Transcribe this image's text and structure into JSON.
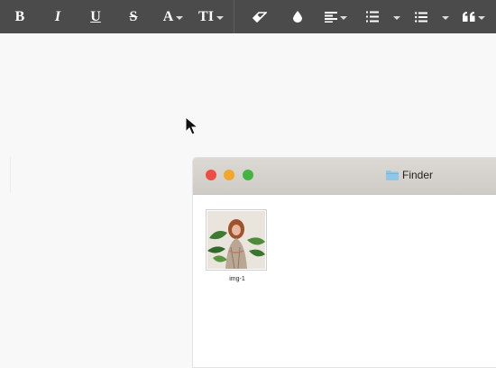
{
  "toolbar": {
    "items": [
      {
        "name": "bold-button",
        "label": "B",
        "style": "bold"
      },
      {
        "name": "italic-button",
        "label": "I",
        "style": "italic"
      },
      {
        "name": "underline-button",
        "label": "U",
        "style": "underline"
      },
      {
        "name": "strikethrough-button",
        "label": "S",
        "style": "strike"
      },
      {
        "name": "font-color-button",
        "label": "A",
        "style": "serif-bold"
      },
      {
        "name": "font-size-button",
        "label": "TI",
        "style": "serif-bold"
      }
    ],
    "icons": [
      "eraser-icon",
      "drop-icon",
      "align-icon",
      "ordered-list-icon",
      "unordered-list-icon",
      "quote-icon"
    ]
  },
  "finder": {
    "title": "Finder",
    "files": [
      {
        "name": "img-1"
      }
    ]
  },
  "colors": {
    "toolbar_bg": "#4b4b4b",
    "close": "#ed4d45",
    "minimize": "#f2a72a",
    "zoom": "#43b440",
    "folder": "#8fc7e8"
  }
}
